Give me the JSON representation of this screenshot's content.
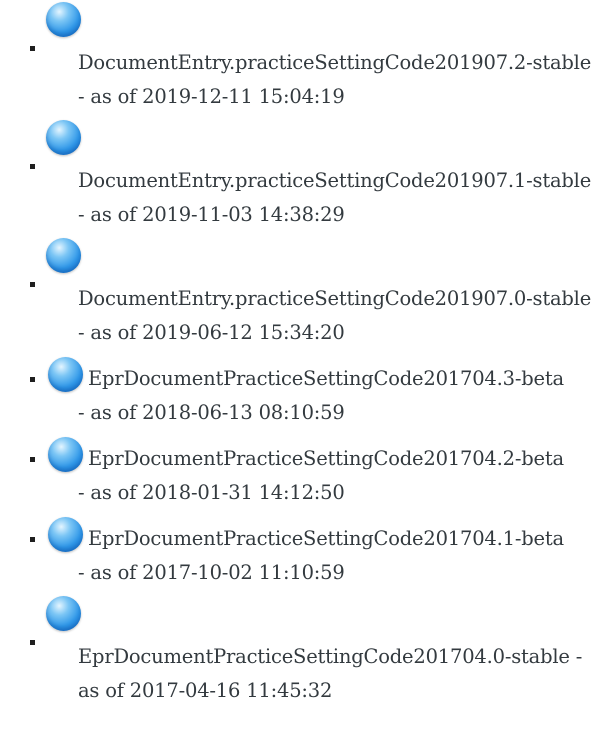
{
  "versions": [
    {
      "name": "DocumentEntry.practiceSettingCode201907.2-stable",
      "date": "- as of 2019-12-11 15:04:19",
      "layout": "stacked",
      "icon": "globe-icon"
    },
    {
      "name": "DocumentEntry.practiceSettingCode201907.1-stable",
      "date": "- as of 2019-11-03 14:38:29",
      "layout": "stacked",
      "icon": "globe-icon"
    },
    {
      "name": "DocumentEntry.practiceSettingCode201907.0-stable",
      "date": "- as of 2019-06-12 15:34:20",
      "layout": "stacked",
      "icon": "globe-icon"
    },
    {
      "name": "EprDocumentPracticeSettingCode201704.3-beta",
      "date": "- as of 2018-06-13 08:10:59",
      "layout": "inline",
      "icon": "globe-icon"
    },
    {
      "name": "EprDocumentPracticeSettingCode201704.2-beta",
      "date": "- as of 2018-01-31 14:12:50",
      "layout": "inline",
      "icon": "globe-icon"
    },
    {
      "name": "EprDocumentPracticeSettingCode201704.1-beta",
      "date": "- as of 2017-10-02 11:10:59",
      "layout": "inline",
      "icon": "globe-icon"
    },
    {
      "name": "EprDocumentPracticeSettingCode201704.0-stable -",
      "date": "as of 2017-04-16 11:45:32",
      "layout": "stacked",
      "icon": "globe-icon"
    }
  ]
}
